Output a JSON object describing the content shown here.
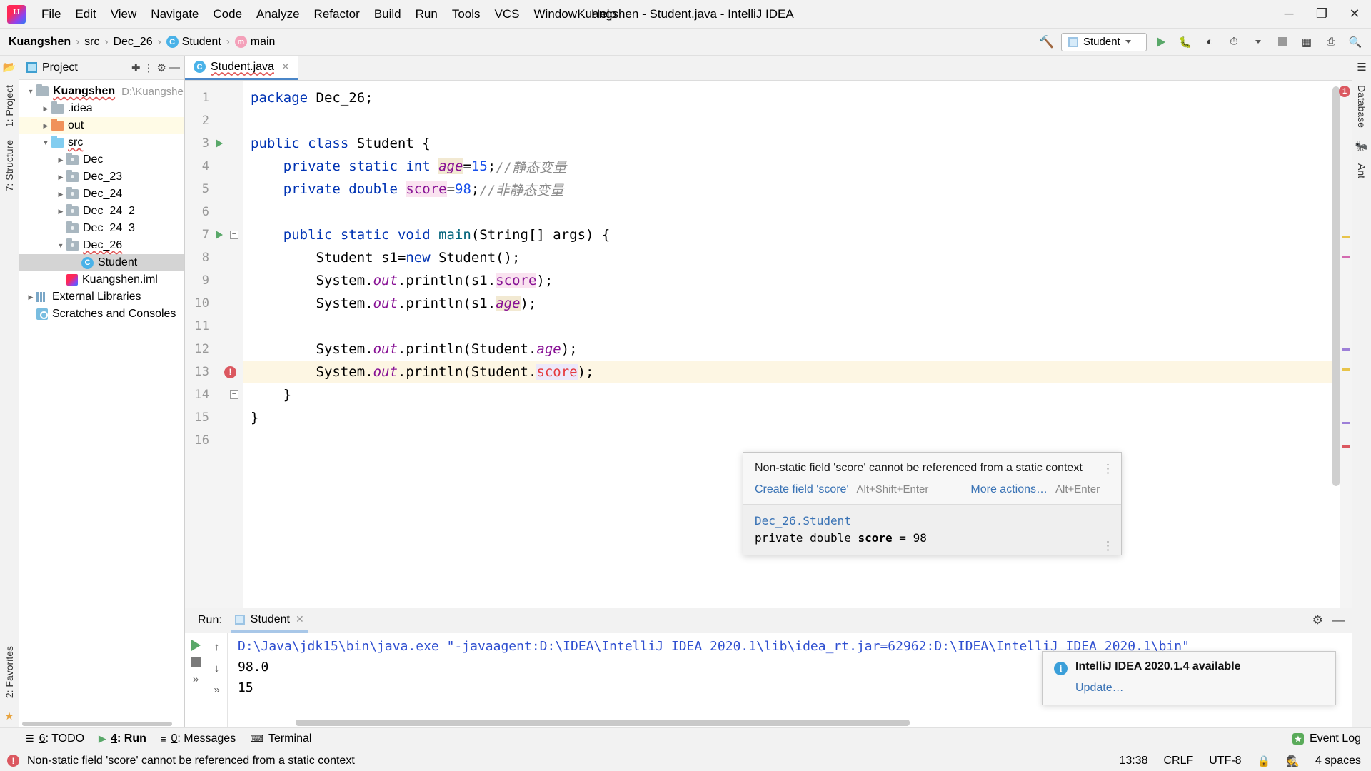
{
  "window": {
    "title": "Kuangshen - Student.java - IntelliJ IDEA",
    "logo": "intellij-logo",
    "minimize": "─",
    "maximize": "❐",
    "close": "✕"
  },
  "menubar": [
    {
      "label": "File",
      "mnemonic": "F"
    },
    {
      "label": "Edit",
      "mnemonic": "E"
    },
    {
      "label": "View",
      "mnemonic": "V"
    },
    {
      "label": "Navigate",
      "mnemonic": "N"
    },
    {
      "label": "Code",
      "mnemonic": "C"
    },
    {
      "label": "Analyze",
      "mnemonic": "z"
    },
    {
      "label": "Refactor",
      "mnemonic": "R"
    },
    {
      "label": "Build",
      "mnemonic": "B"
    },
    {
      "label": "Run",
      "mnemonic": "u"
    },
    {
      "label": "Tools",
      "mnemonic": "T"
    },
    {
      "label": "VCS",
      "mnemonic": "S"
    },
    {
      "label": "Window",
      "mnemonic": "W"
    },
    {
      "label": "Help",
      "mnemonic": "H"
    }
  ],
  "breadcrumb": {
    "items": [
      "Kuangshen",
      "src",
      "Dec_26",
      "Student",
      "main"
    ],
    "separator": "›",
    "class_badge": "C",
    "method_badge": "m"
  },
  "toolbar": {
    "build_icon": "hammer-icon",
    "run_config": "Student",
    "run_icon": "run-icon",
    "debug_icon": "debug-icon",
    "run_coverage_icon": "run-with-coverage-icon",
    "profiler_icon": "profiler-icon",
    "stop_icon": "stop-icon",
    "layout_icon": "layout-icon",
    "updates_icon": "updates-icon",
    "search_icon": "search-icon"
  },
  "left_strip": [
    {
      "label": "1: Project",
      "name": "tool-window-project"
    },
    {
      "label": "7: Structure",
      "name": "tool-window-structure"
    },
    {
      "label": "2: Favorites",
      "name": "tool-window-favorites"
    }
  ],
  "right_strip": [
    {
      "label": "Database",
      "name": "tool-window-database"
    },
    {
      "label": "Ant",
      "name": "tool-window-ant"
    }
  ],
  "project_panel": {
    "title": "Project",
    "locate_icon": "locate-icon",
    "collapse_icon": "collapse-all-icon",
    "settings_icon": "gear-icon",
    "hide_icon": "hide-icon",
    "tree": [
      {
        "label": "Kuangshen",
        "path": "D:\\Kuangshe",
        "depth": 0,
        "arrow": "down",
        "icon": "module-folder",
        "bold": true,
        "wavy": true,
        "highlight": false,
        "selected": false
      },
      {
        "label": ".idea",
        "path": "",
        "depth": 1,
        "arrow": "right",
        "icon": "folder-gray",
        "bold": false,
        "wavy": false,
        "highlight": false,
        "selected": false
      },
      {
        "label": "out",
        "path": "",
        "depth": 1,
        "arrow": "right",
        "icon": "folder-orange",
        "bold": false,
        "wavy": false,
        "highlight": true,
        "selected": false
      },
      {
        "label": "src",
        "path": "",
        "depth": 1,
        "arrow": "down",
        "icon": "folder-blue",
        "bold": false,
        "wavy": true,
        "highlight": false,
        "selected": false
      },
      {
        "label": "Dec",
        "path": "",
        "depth": 2,
        "arrow": "right",
        "icon": "folder-package",
        "bold": false,
        "wavy": false,
        "highlight": false,
        "selected": false
      },
      {
        "label": "Dec_23",
        "path": "",
        "depth": 2,
        "arrow": "right",
        "icon": "folder-package",
        "bold": false,
        "wavy": false,
        "highlight": false,
        "selected": false
      },
      {
        "label": "Dec_24",
        "path": "",
        "depth": 2,
        "arrow": "right",
        "icon": "folder-package",
        "bold": false,
        "wavy": false,
        "highlight": false,
        "selected": false
      },
      {
        "label": "Dec_24_2",
        "path": "",
        "depth": 2,
        "arrow": "right",
        "icon": "folder-package",
        "bold": false,
        "wavy": false,
        "highlight": false,
        "selected": false
      },
      {
        "label": "Dec_24_3",
        "path": "",
        "depth": 2,
        "arrow": "none",
        "icon": "folder-package",
        "bold": false,
        "wavy": false,
        "highlight": false,
        "selected": false
      },
      {
        "label": "Dec_26",
        "path": "",
        "depth": 2,
        "arrow": "down",
        "icon": "folder-package",
        "bold": false,
        "wavy": true,
        "highlight": false,
        "selected": false
      },
      {
        "label": "Student",
        "path": "",
        "depth": 3,
        "arrow": "none",
        "icon": "java-class",
        "bold": false,
        "wavy": false,
        "highlight": false,
        "selected": true
      },
      {
        "label": "Kuangshen.iml",
        "path": "",
        "depth": 2,
        "arrow": "none",
        "icon": "iml-file",
        "bold": false,
        "wavy": false,
        "highlight": false,
        "selected": false
      },
      {
        "label": "External Libraries",
        "path": "",
        "depth": 0,
        "arrow": "right",
        "icon": "libraries",
        "bold": false,
        "wavy": false,
        "highlight": false,
        "selected": false
      },
      {
        "label": "Scratches and Consoles",
        "path": "",
        "depth": 0,
        "arrow": "none",
        "icon": "scratches",
        "bold": false,
        "wavy": false,
        "highlight": false,
        "selected": false
      }
    ]
  },
  "editor": {
    "tab": {
      "label": "Student.java",
      "icon": "java-class-icon",
      "close": "✕"
    },
    "lines": [
      {
        "n": 1,
        "run": false,
        "fold": "",
        "error": false,
        "tokens": [
          {
            "t": "package ",
            "c": "kw"
          },
          {
            "t": "Dec_26",
            "c": "ident"
          },
          {
            "t": ";",
            "c": "ident"
          }
        ]
      },
      {
        "n": 2,
        "run": false,
        "fold": "",
        "error": false,
        "tokens": []
      },
      {
        "n": 3,
        "run": true,
        "fold": "",
        "error": false,
        "tokens": [
          {
            "t": "public class ",
            "c": "kw"
          },
          {
            "t": "Student",
            "c": "typ"
          },
          {
            "t": " {",
            "c": "ident"
          }
        ]
      },
      {
        "n": 4,
        "run": false,
        "fold": "",
        "error": false,
        "tokens": [
          {
            "t": "    ",
            "c": "ident"
          },
          {
            "t": "private static int ",
            "c": "kw"
          },
          {
            "t": "age",
            "c": "fld-static"
          },
          {
            "t": "=",
            "c": "ident"
          },
          {
            "t": "15",
            "c": "num"
          },
          {
            "t": ";",
            "c": "ident"
          },
          {
            "t": "//静态变量",
            "c": "cmt"
          }
        ]
      },
      {
        "n": 5,
        "run": false,
        "fold": "",
        "error": false,
        "tokens": [
          {
            "t": "    ",
            "c": "ident"
          },
          {
            "t": "private double ",
            "c": "kw"
          },
          {
            "t": "score",
            "c": "fld-inst"
          },
          {
            "t": "=",
            "c": "ident"
          },
          {
            "t": "98",
            "c": "num"
          },
          {
            "t": ";",
            "c": "ident"
          },
          {
            "t": "//非静态变量",
            "c": "cmt"
          }
        ]
      },
      {
        "n": 6,
        "run": false,
        "fold": "",
        "error": false,
        "tokens": []
      },
      {
        "n": 7,
        "run": true,
        "fold": "minus",
        "error": false,
        "tokens": [
          {
            "t": "    ",
            "c": "ident"
          },
          {
            "t": "public static void ",
            "c": "kw"
          },
          {
            "t": "main",
            "c": "mth"
          },
          {
            "t": "(String[] args) {",
            "c": "ident"
          }
        ]
      },
      {
        "n": 8,
        "run": false,
        "fold": "",
        "error": false,
        "tokens": [
          {
            "t": "        Student s1=",
            "c": "ident"
          },
          {
            "t": "new ",
            "c": "kw"
          },
          {
            "t": "Student();",
            "c": "ident"
          }
        ]
      },
      {
        "n": 9,
        "run": false,
        "fold": "",
        "error": false,
        "tokens": [
          {
            "t": "        System.",
            "c": "ident"
          },
          {
            "t": "out",
            "c": "fld-static-p"
          },
          {
            "t": ".println(s1.",
            "c": "ident"
          },
          {
            "t": "score",
            "c": "fld-inst"
          },
          {
            "t": ");",
            "c": "ident"
          }
        ]
      },
      {
        "n": 10,
        "run": false,
        "fold": "",
        "error": false,
        "tokens": [
          {
            "t": "        System.",
            "c": "ident"
          },
          {
            "t": "out",
            "c": "fld-static-p"
          },
          {
            "t": ".println(s1.",
            "c": "ident"
          },
          {
            "t": "age",
            "c": "fld-static"
          },
          {
            "t": ");",
            "c": "ident"
          }
        ]
      },
      {
        "n": 11,
        "run": false,
        "fold": "",
        "error": false,
        "tokens": []
      },
      {
        "n": 12,
        "run": false,
        "fold": "",
        "error": false,
        "tokens": [
          {
            "t": "        System.",
            "c": "ident"
          },
          {
            "t": "out",
            "c": "fld-static-p"
          },
          {
            "t": ".println(Student.",
            "c": "ident"
          },
          {
            "t": "age",
            "c": "fld-static-p"
          },
          {
            "t": ");",
            "c": "ident"
          }
        ]
      },
      {
        "n": 13,
        "run": false,
        "fold": "",
        "error": true,
        "tokens": [
          {
            "t": "        System.",
            "c": "ident"
          },
          {
            "t": "out",
            "c": "fld-static-p"
          },
          {
            "t": ".println(Student.",
            "c": "ident"
          },
          {
            "t": "score",
            "c": "fld-err"
          },
          {
            "t": ");",
            "c": "ident"
          }
        ]
      },
      {
        "n": 14,
        "run": false,
        "fold": "minus",
        "error": false,
        "tokens": [
          {
            "t": "    }",
            "c": "ident"
          }
        ]
      },
      {
        "n": 15,
        "run": false,
        "fold": "",
        "error": false,
        "tokens": [
          {
            "t": "}",
            "c": "ident"
          }
        ]
      },
      {
        "n": 16,
        "run": false,
        "fold": "",
        "error": false,
        "tokens": []
      }
    ],
    "error_gutter_icon": "error-icon",
    "error_marker_count": "1"
  },
  "inspection_popup": {
    "message": "Non-static field 'score' cannot be referenced from a static context",
    "primary_action": "Create field 'score'",
    "primary_shortcut": "Alt+Shift+Enter",
    "secondary_action": "More actions…",
    "secondary_shortcut": "Alt+Enter",
    "menu_icon": "kebab-menu-icon",
    "preview_class": "Dec_26.Student",
    "preview_signature_prefix": "private double ",
    "preview_signature_name": "score",
    "preview_signature_suffix": " = 98"
  },
  "run_panel": {
    "label": "Run:",
    "tab": "Student",
    "tab_close": "✕",
    "settings_icon": "gear-icon",
    "hide_icon": "hide-icon",
    "rerun_icon": "rerun-icon",
    "stop_icon": "stop-icon",
    "up_icon": "↑",
    "down_icon": "↓",
    "more_icon": "»",
    "console": [
      {
        "text": "D:\\Java\\jdk15\\bin\\java.exe \"-javaagent:D:\\IDEA\\IntelliJ IDEA 2020.1\\lib\\idea_rt.jar=62962:D:\\IDEA\\IntelliJ IDEA 2020.1\\bin\"",
        "kind": "cmd"
      },
      {
        "text": "98.0",
        "kind": "out"
      },
      {
        "text": "15",
        "kind": "out"
      }
    ]
  },
  "notification": {
    "icon": "info-icon",
    "title": "IntelliJ IDEA 2020.1.4 available",
    "link": "Update…"
  },
  "bottom_tabs": [
    {
      "label": "6: TODO",
      "icon": "todo-icon",
      "active": false
    },
    {
      "label": "4: Run",
      "icon": "run-icon",
      "active": true
    },
    {
      "label": "0: Messages",
      "icon": "messages-icon",
      "active": false
    },
    {
      "label": "Terminal",
      "icon": "terminal-icon",
      "active": false
    }
  ],
  "event_log": {
    "label": "Event Log",
    "icon": "event-log-icon"
  },
  "statusbar": {
    "error_icon": "error-icon",
    "message": "Non-static field 'score' cannot be referenced from a static context",
    "time": "13:38",
    "line_separator": "CRLF",
    "encoding": "UTF-8",
    "lock_icon": "lock-icon",
    "branch_icon": "user-icon",
    "indent": "4 spaces"
  },
  "colors": {
    "accent": "#4a86c8",
    "error": "#db5860",
    "keyword": "#0033b3",
    "comment": "#8c8c8c",
    "field": "#871094",
    "number": "#1750eb",
    "run_green": "#59a869",
    "link": "#3a73b5"
  }
}
